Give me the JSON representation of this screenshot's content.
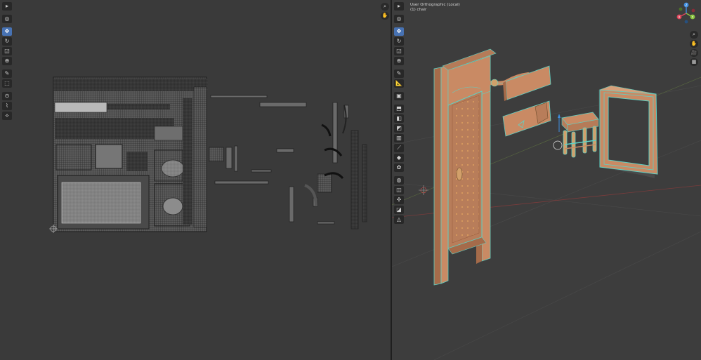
{
  "viewport": {
    "view_label": "User Orthographic (Local)",
    "object_label": "(1) chair"
  },
  "gizmo": {
    "x": "X",
    "y": "Y",
    "z": "Z"
  },
  "colors": {
    "uv_bg": "#3a3a3a",
    "viewport_bg": "#3d3d3d",
    "mesh_orange": "#c98a64",
    "selection_cyan": "#5fd1c4",
    "active_tool": "#4772b3",
    "axis_x": "#e0445a",
    "axis_y": "#8cc63f",
    "axis_z": "#3f8ee0"
  },
  "uv_toolbar": [
    {
      "icon": "select-cursor-icon",
      "glyph": "▸",
      "active": false
    },
    {
      "icon": "cursor-icon",
      "glyph": "◎",
      "active": false
    },
    {
      "icon": "move-icon",
      "glyph": "✥",
      "active": true
    },
    {
      "icon": "rotate-icon",
      "glyph": "↻",
      "active": false
    },
    {
      "icon": "scale-icon",
      "glyph": "◲",
      "active": false
    },
    {
      "icon": "transform-icon",
      "glyph": "⊕",
      "active": false
    },
    {
      "icon": "annotate-icon",
      "glyph": "✎",
      "active": false
    },
    {
      "icon": "rip-icon",
      "glyph": "⬚",
      "active": false
    },
    {
      "icon": "grab-icon",
      "glyph": "⊙",
      "active": false
    },
    {
      "icon": "relax-icon",
      "glyph": "⌇",
      "active": false
    },
    {
      "icon": "pinch-icon",
      "glyph": "⟡",
      "active": false
    }
  ],
  "uv_nav": [
    {
      "icon": "zoom-icon",
      "glyph": "⌕"
    },
    {
      "icon": "pan-hand-icon",
      "glyph": "✋"
    }
  ],
  "vp_toolbar": [
    {
      "icon": "select-cursor-icon",
      "glyph": "▸",
      "active": false
    },
    {
      "icon": "cursor-icon",
      "glyph": "◎",
      "active": false
    },
    {
      "icon": "move-icon",
      "glyph": "✥",
      "active": true
    },
    {
      "icon": "rotate-icon",
      "glyph": "↻",
      "active": false
    },
    {
      "icon": "scale-icon",
      "glyph": "◲",
      "active": false
    },
    {
      "icon": "transform-icon",
      "glyph": "⊕",
      "active": false
    },
    {
      "icon": "annotate-icon",
      "glyph": "✎",
      "active": false
    },
    {
      "icon": "measure-icon",
      "glyph": "📐",
      "active": false
    },
    {
      "icon": "add-cube-icon",
      "glyph": "▣",
      "active": false
    },
    {
      "icon": "extrude-icon",
      "glyph": "⬒",
      "active": false
    },
    {
      "icon": "inset-icon",
      "glyph": "◧",
      "active": false
    },
    {
      "icon": "bevel-icon",
      "glyph": "◩",
      "active": false
    },
    {
      "icon": "loop-cut-icon",
      "glyph": "▥",
      "active": false
    },
    {
      "icon": "knife-icon",
      "glyph": "⟋",
      "active": false
    },
    {
      "icon": "poly-build-icon",
      "glyph": "◆",
      "active": false
    },
    {
      "icon": "spin-icon",
      "glyph": "✿",
      "active": false
    },
    {
      "icon": "smooth-icon",
      "glyph": "◍",
      "active": false
    },
    {
      "icon": "edge-slide-icon",
      "glyph": "◫",
      "active": false
    },
    {
      "icon": "shrink-fatten-icon",
      "glyph": "✣",
      "active": false
    },
    {
      "icon": "shear-icon",
      "glyph": "◪",
      "active": false
    },
    {
      "icon": "rip-region-icon",
      "glyph": "◬",
      "active": false
    }
  ],
  "vp_nav": [
    {
      "icon": "zoom-icon",
      "glyph": "⌕"
    },
    {
      "icon": "pan-hand-icon",
      "glyph": "✋"
    },
    {
      "icon": "camera-icon",
      "glyph": "🎥"
    },
    {
      "icon": "perspective-grid-icon",
      "glyph": "▦"
    }
  ]
}
